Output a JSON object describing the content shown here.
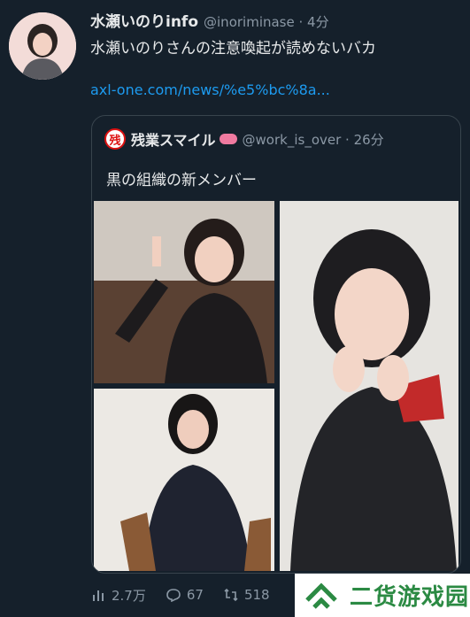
{
  "tweet": {
    "name": "水瀬いのりinfo",
    "handle": "@inoriminase · 4分",
    "text": "水瀬いのりさんの注意喚起が読めないバカ",
    "link": "axl-one.com/news/%e5%bc%8a..."
  },
  "quote": {
    "badge": "残",
    "name": "残業スマイル",
    "handle": "@work_is_over · 26分",
    "text": "黒の組織の新メンバー"
  },
  "actions": {
    "views": "2.7万",
    "replies": "67",
    "retweets": "518"
  },
  "watermark": {
    "text": "二货游戏园"
  },
  "colors": {
    "background": "#15202b",
    "link": "#1d9bf0",
    "muted": "#8b98a5",
    "watermark_green": "#2b8a43"
  }
}
